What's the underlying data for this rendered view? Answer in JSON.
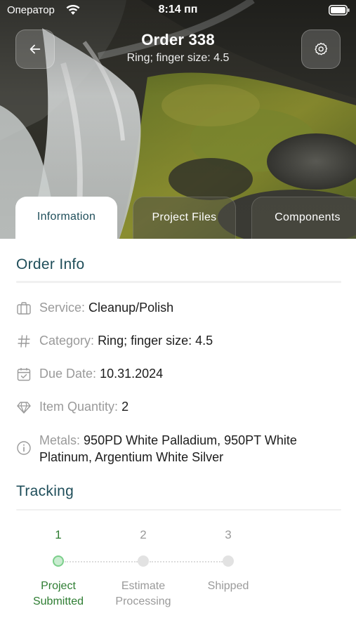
{
  "status_bar": {
    "carrier": "Оператор",
    "time": "8:14 пп"
  },
  "header": {
    "title": "Order 338",
    "subtitle": "Ring; finger size: 4.5"
  },
  "tabs": [
    {
      "label": "Information",
      "active": true
    },
    {
      "label": "Project Files",
      "active": false
    },
    {
      "label": "Components",
      "active": false
    }
  ],
  "order_info": {
    "title": "Order Info",
    "rows": [
      {
        "icon": "briefcase-icon",
        "label": "Service:",
        "value": "Cleanup/Polish"
      },
      {
        "icon": "hash-icon",
        "label": "Category:",
        "value": "Ring; finger size: 4.5"
      },
      {
        "icon": "calendar-check-icon",
        "label": "Due Date:",
        "value": "10.31.2024"
      },
      {
        "icon": "diamond-icon",
        "label": "Item Quantity:",
        "value": "2"
      },
      {
        "icon": "info-circle-icon",
        "label": "Metals:",
        "value": "950PD White Palladium, 950PT White",
        "value_line2": "Platinum, Argentium White Silver"
      }
    ]
  },
  "tracking": {
    "title": "Tracking",
    "steps": [
      {
        "number": "1",
        "line1": "Project",
        "line2": "Submitted",
        "state": "active"
      },
      {
        "number": "2",
        "line1": "Estimate",
        "line2": "Processing",
        "state": "pending"
      },
      {
        "number": "3",
        "line1": "Shipped",
        "line2": "",
        "state": "pending"
      }
    ]
  },
  "colors": {
    "accent": "#1f4e5a",
    "active_step": "#2e7d32",
    "muted": "#9a9a9a"
  }
}
